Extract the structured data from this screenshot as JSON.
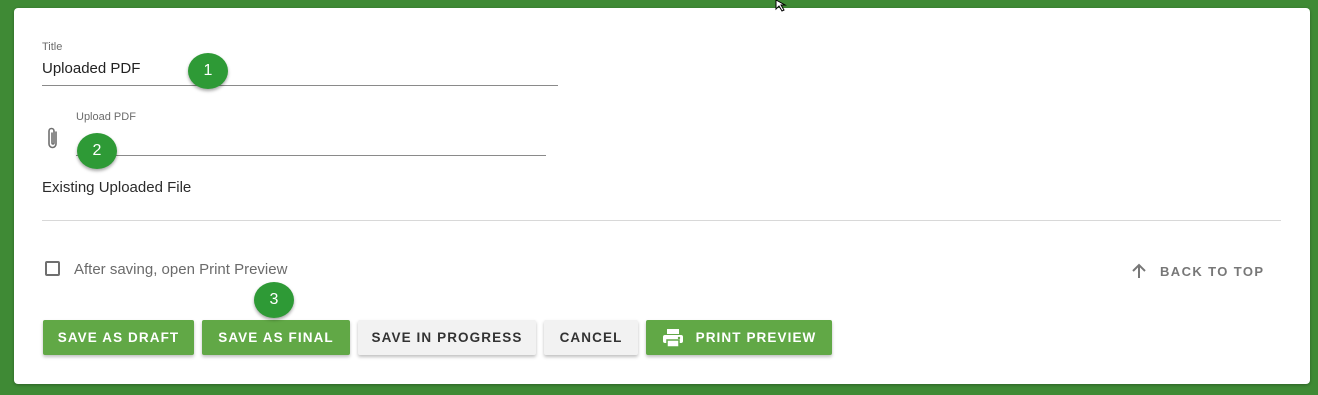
{
  "form": {
    "title_field": {
      "label": "Title",
      "value": "Uploaded PDF"
    },
    "upload_field": {
      "label": "Upload PDF",
      "value": ""
    },
    "existing_file_label": "Existing Uploaded File",
    "print_preview_checkbox": {
      "label": "After saving, open Print Preview",
      "checked": false
    }
  },
  "markers": [
    "1",
    "2",
    "3"
  ],
  "back_to_top": {
    "label": "BACK TO TOP",
    "icon": "arrow-up-icon"
  },
  "buttons": {
    "save_draft": "SAVE AS DRAFT",
    "save_final": "SAVE AS FINAL",
    "save_in_progress": "SAVE IN PROGRESS",
    "cancel": "CANCEL",
    "print_preview": "PRINT PREVIEW"
  },
  "icons": {
    "attachment": "paperclip-icon",
    "print": "printer-icon"
  },
  "colors": {
    "background": "#3f8a35",
    "primary_button": "#61a846",
    "secondary_button": "#f2f2f2",
    "marker": "#2e9a36"
  }
}
